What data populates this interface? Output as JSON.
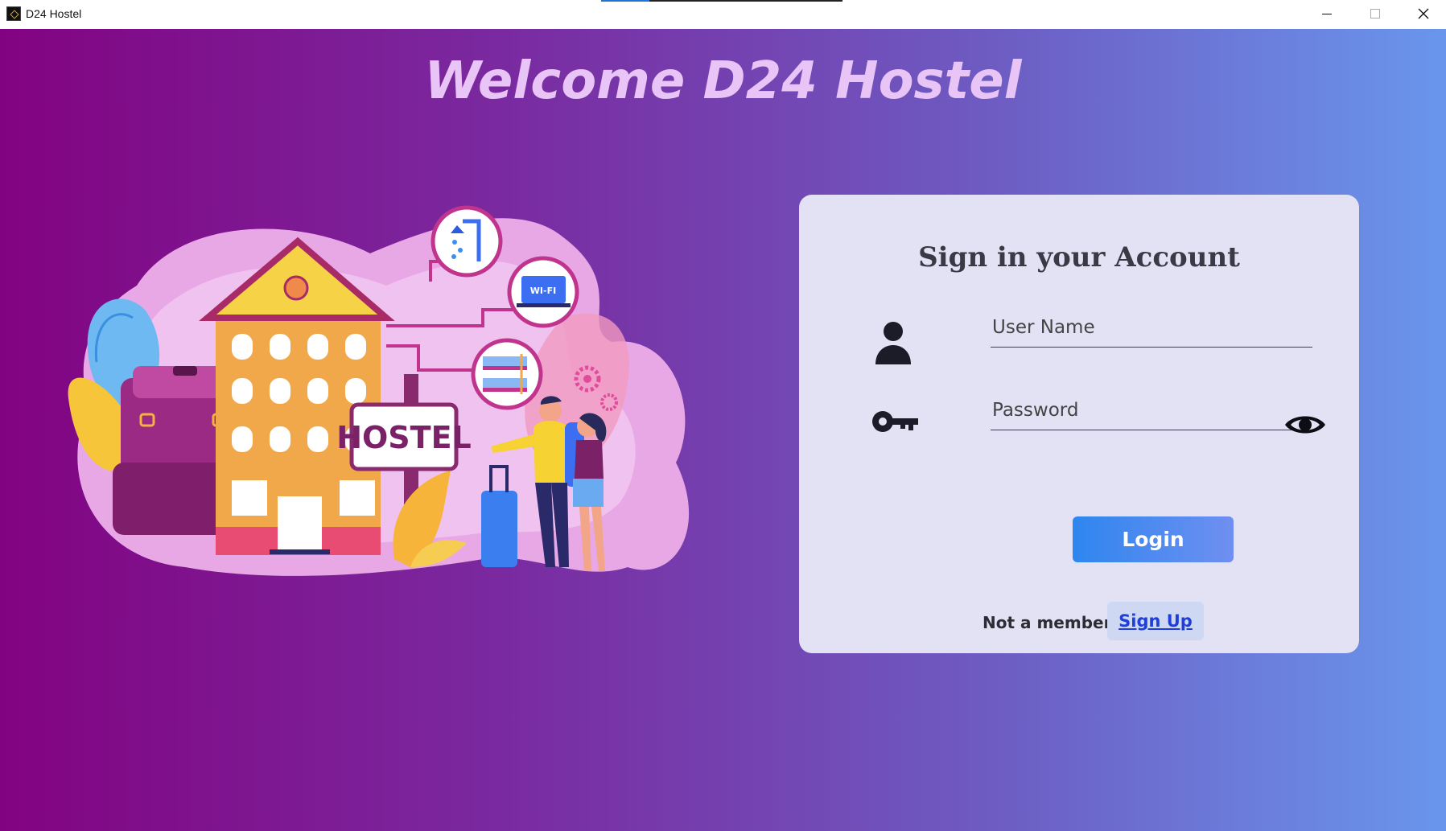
{
  "window": {
    "title": "D24 Hostel",
    "controls": {
      "minimize": "minimize-icon",
      "maximize": "maximize-icon",
      "close": "close-icon"
    }
  },
  "header": {
    "welcome": "Welcome D24 Hostel"
  },
  "illustration": {
    "sign_text": "HOSTEL",
    "wifi_text": "WI-FI"
  },
  "login": {
    "title": "Sign in your Account",
    "username_placeholder": "User Name",
    "username_value": "",
    "password_placeholder": "Password",
    "password_value": "",
    "login_label": "Login",
    "not_member": "Not a member ?",
    "signup_label": "Sign Up"
  },
  "colors": {
    "gradient_start": "#820381",
    "gradient_end": "#6996ec",
    "card_bg": "#e3e1f4",
    "welcome_text": "#e8c5f6",
    "login_button": "#2e86ef",
    "signup_text": "#1f3fd6"
  }
}
